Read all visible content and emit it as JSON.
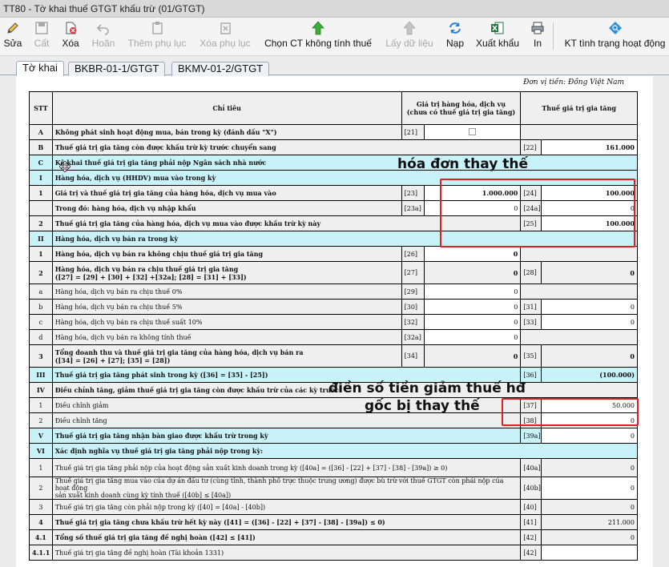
{
  "window": {
    "title": "TT80 - Tờ khai thuế GTGT khấu trừ (01/GTGT)"
  },
  "toolbar": {
    "edit": "Sửa",
    "save": "Cất",
    "delete": "Xóa",
    "undo": "Hoãn",
    "add_appendix": "Thêm phụ lục",
    "delete_appendix": "Xóa phụ lục",
    "select_ct": "Chọn CT không tính thuế",
    "get_data": "Lấy dữ liệu",
    "reload": "Nạp",
    "export_excel": "Xuất khẩu",
    "print": "In",
    "check_status": "KT tình trạng hoạt động"
  },
  "tabs": [
    "Tờ khai",
    "BKBR-01-1/GTGT",
    "BKMV-01-2/GTGT"
  ],
  "currency_note": "Đơn vị tiền: Đồng Việt Nam",
  "header": {
    "stt": "STT",
    "indicator": "Chỉ tiêu",
    "goods_value": "Giá trị hàng hóa, dịch vụ",
    "goods_value_note": "(chưa có thuế giá trị gia tăng)",
    "vat": "Thuế giá trị gia tăng"
  },
  "rows": {
    "A": {
      "stt": "A",
      "label": "Không phát sinh hoạt động mua, bán trong kỳ (đánh dấu \"X\")",
      "code": "[21]"
    },
    "B": {
      "stt": "B",
      "label": "Thuế giá trị gia tăng còn được khấu trừ kỳ trước chuyển sang",
      "code": "[22]",
      "value": "161.000"
    },
    "C": {
      "stt": "C",
      "label": "Kê khai thuế giá trị gia tăng phải nộp Ngân sách nhà nước"
    },
    "I": {
      "stt": "I",
      "label": "Hàng hóa, dịch vụ (HHDV) mua vào trong kỳ"
    },
    "I1": {
      "stt": "1",
      "label": "Giá trị và thuế giá trị gia tăng của hàng hóa, dịch vụ mua vào",
      "code1": "[23]",
      "value1": "1.000.000",
      "code2": "[24]",
      "value2": "100.000"
    },
    "I1a": {
      "stt": "",
      "label": "Trong đó: hàng hóa, dịch vụ nhập khẩu",
      "code1": "[23a]",
      "value1": "0",
      "code2": "[24a]",
      "value2": "0"
    },
    "I2": {
      "stt": "2",
      "label": "Thuế giá trị gia tăng của hàng hóa, dịch vụ mua vào được khấu trừ kỳ này",
      "code2": "[25]",
      "value2": "100.000"
    },
    "II": {
      "stt": "II",
      "label": "Hàng hóa, dịch vụ bán ra trong kỳ"
    },
    "II1": {
      "stt": "1",
      "label": "Hàng hóa, dịch vụ bán ra không chịu thuế giá trị gia tăng",
      "code1": "[26]",
      "value1": "0"
    },
    "II2": {
      "stt": "2",
      "label": "Hàng hóa, dịch vụ bán ra chịu thuế giá trị gia tăng",
      "label2": "([27] = [29] + [30] + [32] +[32a]; [28] = [31] + [33])",
      "code1": "[27]",
      "value1": "0",
      "code2": "[28]",
      "value2": "0"
    },
    "IIa": {
      "stt": "a",
      "label": "Hàng hóa, dịch vụ bán ra chịu thuế 0%",
      "code1": "[29]",
      "value1": "0"
    },
    "IIb": {
      "stt": "b",
      "label": "Hàng hóa, dịch vụ bán ra chịu thuế 5%",
      "code1": "[30]",
      "value1": "0",
      "code2": "[31]",
      "value2": "0"
    },
    "IIc": {
      "stt": "c",
      "label": "Hàng hóa, dịch vụ bán ra chịu thuế suất 10%",
      "code1": "[32]",
      "value1": "0",
      "code2": "[33]",
      "value2": "0"
    },
    "IId": {
      "stt": "d",
      "label": "Hàng hóa, dịch vụ bán ra không tính thuế",
      "code1": "[32a]",
      "value1": "0"
    },
    "II3": {
      "stt": "3",
      "label": "Tổng doanh thu và thuế giá trị gia tăng của hàng hóa, dịch vụ bán ra",
      "label2": "([34] = [26] + [27]; [35] = [28])",
      "code1": "[34]",
      "value1": "0",
      "code2": "[35]",
      "value2": "0"
    },
    "III": {
      "stt": "III",
      "label": "Thuế giá trị gia tăng phát sinh trong kỳ ([36] = [35] - [25])",
      "code2": "[36]",
      "value2": "(100.000)"
    },
    "IV": {
      "stt": "IV",
      "label": "Điều chỉnh tăng, giảm thuế giá trị gia tăng còn được khấu trừ của các kỳ trước"
    },
    "IV1": {
      "stt": "1",
      "label": "Điều chỉnh giảm",
      "code2": "[37]",
      "value2": "50.000"
    },
    "IV2": {
      "stt": "2",
      "label": "Điều chỉnh tăng",
      "code2": "[38]",
      "value2": "0"
    },
    "V": {
      "stt": "V",
      "label": "Thuế giá trị gia tăng nhận bàn giao được khấu trừ trong kỳ",
      "code2": "[39a]",
      "value2": "0"
    },
    "VI": {
      "stt": "VI",
      "label": "Xác định nghĩa vụ thuế giá trị gia tăng phải nộp trong kỳ:"
    },
    "VI1": {
      "stt": "1",
      "label": "Thuế giá trị gia tăng phải nộp của hoạt động sản xuất kinh doanh trong kỳ ([40a] = ([36] - [22] + [37] - [38] - [39a]) ≥ 0)",
      "code2": "[40a]",
      "value2": "0"
    },
    "VI2": {
      "stt": "2",
      "label": "Thuế giá trị gia tăng mua vào của dự án đầu tư (cùng tỉnh, thành phố trực thuộc trung ương) được bù trừ với thuế GTGT còn phải nộp của hoạt động",
      "label2": "sản xuất kinh doanh cùng kỳ tính thuế ([40b] ≤ [40a])",
      "code2": "[40b]",
      "value2": "0"
    },
    "VI3": {
      "stt": "3",
      "label": "Thuế giá trị gia tăng còn phải nộp trong kỳ ([40] = [40a] - [40b])",
      "code2": "[40]",
      "value2": "0"
    },
    "VI4": {
      "stt": "4",
      "label": "Thuế giá trị gia tăng chưa khấu trừ hết kỳ này ([41] = ([36] - [22] + [37] - [38] - [39a]) ≤ 0)",
      "code2": "[41]",
      "value2": "211.000"
    },
    "VI41": {
      "stt": "4.1",
      "label": "Tổng số thuế giá trị gia tăng đề nghị hoàn ([42] ≤ [41])",
      "code2": "[42]",
      "value2": "0"
    },
    "VI411": {
      "stt": "4.1.1",
      "label": "Thuế giá trị gia tăng đề nghị hoàn (Tài khoản 1331)",
      "code2": "[42]",
      "value2": ""
    }
  },
  "annotations": {
    "replacement_invoice": "hóa đơn thay thế",
    "fill_reduction_line1": "điền số tiền giảm thuế hđ",
    "fill_reduction_line2": "gốc bị thay thế"
  },
  "colors": {
    "section_bg": "#c9f1f8",
    "row_gray": "#efefef",
    "annotation_box": "#e02020"
  }
}
